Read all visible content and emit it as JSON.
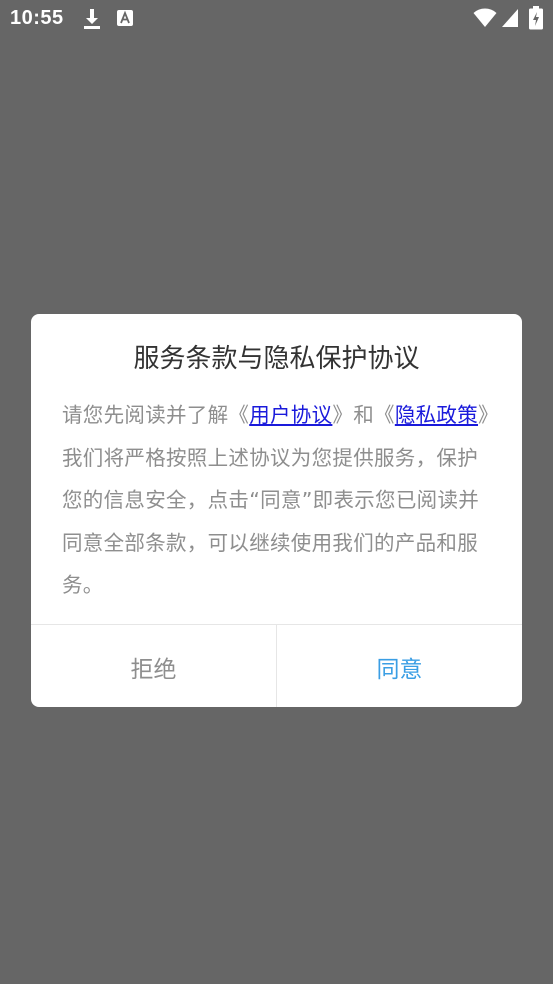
{
  "status_bar": {
    "time": "10:55"
  },
  "dialog": {
    "title": "服务条款与隐私保护协议",
    "body": {
      "part1": "请您先阅读并了解《",
      "link_user_agreement": "用户协议",
      "part2": "》和《",
      "link_privacy_policy": "隐私政策",
      "part3": "》我们将严格按照上述协议为您提供服务，保护您的信息安全，点击“同意”即表示您已阅读并同意全部条款，可以继续使用我们的产品和服务。"
    },
    "reject_label": "拒绝",
    "agree_label": "同意"
  },
  "colors": {
    "overlay": "#666666",
    "agree_accent": "#3a9ee4",
    "link": "#1a1adb"
  }
}
